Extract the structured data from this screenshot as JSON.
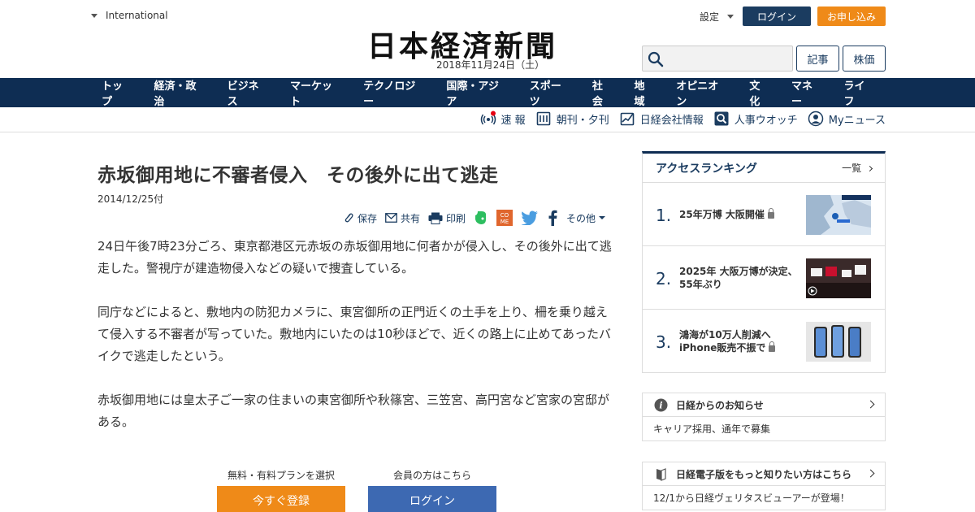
{
  "header": {
    "international": "International",
    "logo": "日本経済新聞",
    "date": "2018年11月24日（土）",
    "settings": "設定",
    "login": "ログイン",
    "apply": "お申し込み",
    "search_placeholder": "",
    "article_btn": "記事",
    "stock_btn": "株価"
  },
  "nav": [
    "トップ",
    "経済・政治",
    "ビジネス",
    "マーケット",
    "テクノロジー",
    "国際・アジア",
    "スポーツ",
    "社会",
    "地域",
    "オピニオン",
    "文化",
    "マネー",
    "ライフ"
  ],
  "subnav": {
    "breaking": "速 報",
    "paper": "朝刊・夕刊",
    "company": "日経会社情報",
    "people": "人事ウオッチ",
    "mynews": "Myニュース"
  },
  "article": {
    "headline": "赤坂御用地に不審者侵入　その後外に出て逃走",
    "date": "2014/12/25付",
    "share": {
      "save": "保存",
      "share": "共有",
      "print": "印刷",
      "more": "その他"
    },
    "paragraphs": [
      "24日午後7時23分ごろ、東京都港区元赤坂の赤坂御用地に何者かが侵入し、その後外に出て逃走した。警視庁が建造物侵入などの疑いで捜査している。",
      "同庁などによると、敷地内の防犯カメラに、東宮御所の正門近くの土手を上り、柵を乗り越えて侵入する不審者が写っていた。敷地内にいたのは10秒ほどで、近くの路上に止めてあったバイクで逃走したという。",
      "赤坂御用地には皇太子ご一家の住まいの東宮御所や秋篠宮、三笠宮、高円宮など宮家の宮邸がある。"
    ],
    "cta": {
      "plan_label": "無料・有料プランを選択",
      "member_label": "会員の方はこちら",
      "register": "今すぐ登録",
      "login": "ログイン"
    }
  },
  "ranking": {
    "title": "アクセスランキング",
    "more": "一覧",
    "items": [
      {
        "num": "1.",
        "text": "25年万博 大阪開催"
      },
      {
        "num": "2.",
        "text": "2025年 大阪万博が決定、55年ぶり"
      },
      {
        "num": "3.",
        "text": "鴻海が10万人削減へ iPhone販売不振で"
      }
    ]
  },
  "notice": {
    "title": "日経からのお知らせ",
    "body": "キャリア採用、通年で募集"
  },
  "digital": {
    "title": "日経電子版をもっと知りたい方はこちら",
    "body": "12/1から日経ヴェリタスビューアーが登場！"
  },
  "colors": {
    "navy": "#0e2d53",
    "orange": "#ef8a18",
    "blue_button": "#3d69b2"
  }
}
